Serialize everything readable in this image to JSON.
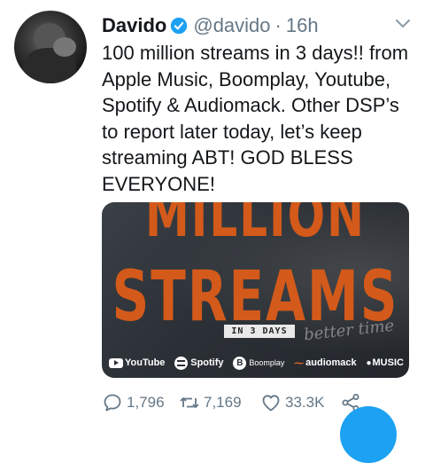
{
  "tweet": {
    "author_name": "Davido",
    "handle": "@davido",
    "separator": "·",
    "time": "16h",
    "verified": true,
    "text": "100 million streams in 3 days!! from Apple Music, Boomplay, Youtube, Spotify & Audiomack. Other DSP’s to report later today, let’s keep streaming ABT! GOD BLESS EVERYONE!",
    "media": {
      "headline_1": "MILLION",
      "headline_2": "STREAMS",
      "tag": "IN 3 DAYS",
      "script_text": "better time",
      "brands": {
        "youtube": "YouTube",
        "spotify": "Spotify",
        "boomplay_icon": "B",
        "boomplay": "Boomplay",
        "audiomack": "audiomack",
        "apple_music": "MUSIC"
      },
      "accent_color": "#d35a1a"
    },
    "actions": {
      "replies": "1,796",
      "retweets": "7,169",
      "likes": "33.3K"
    }
  },
  "colors": {
    "text": "#14171a",
    "secondary": "#657786",
    "brand_blue": "#1da1f2"
  }
}
